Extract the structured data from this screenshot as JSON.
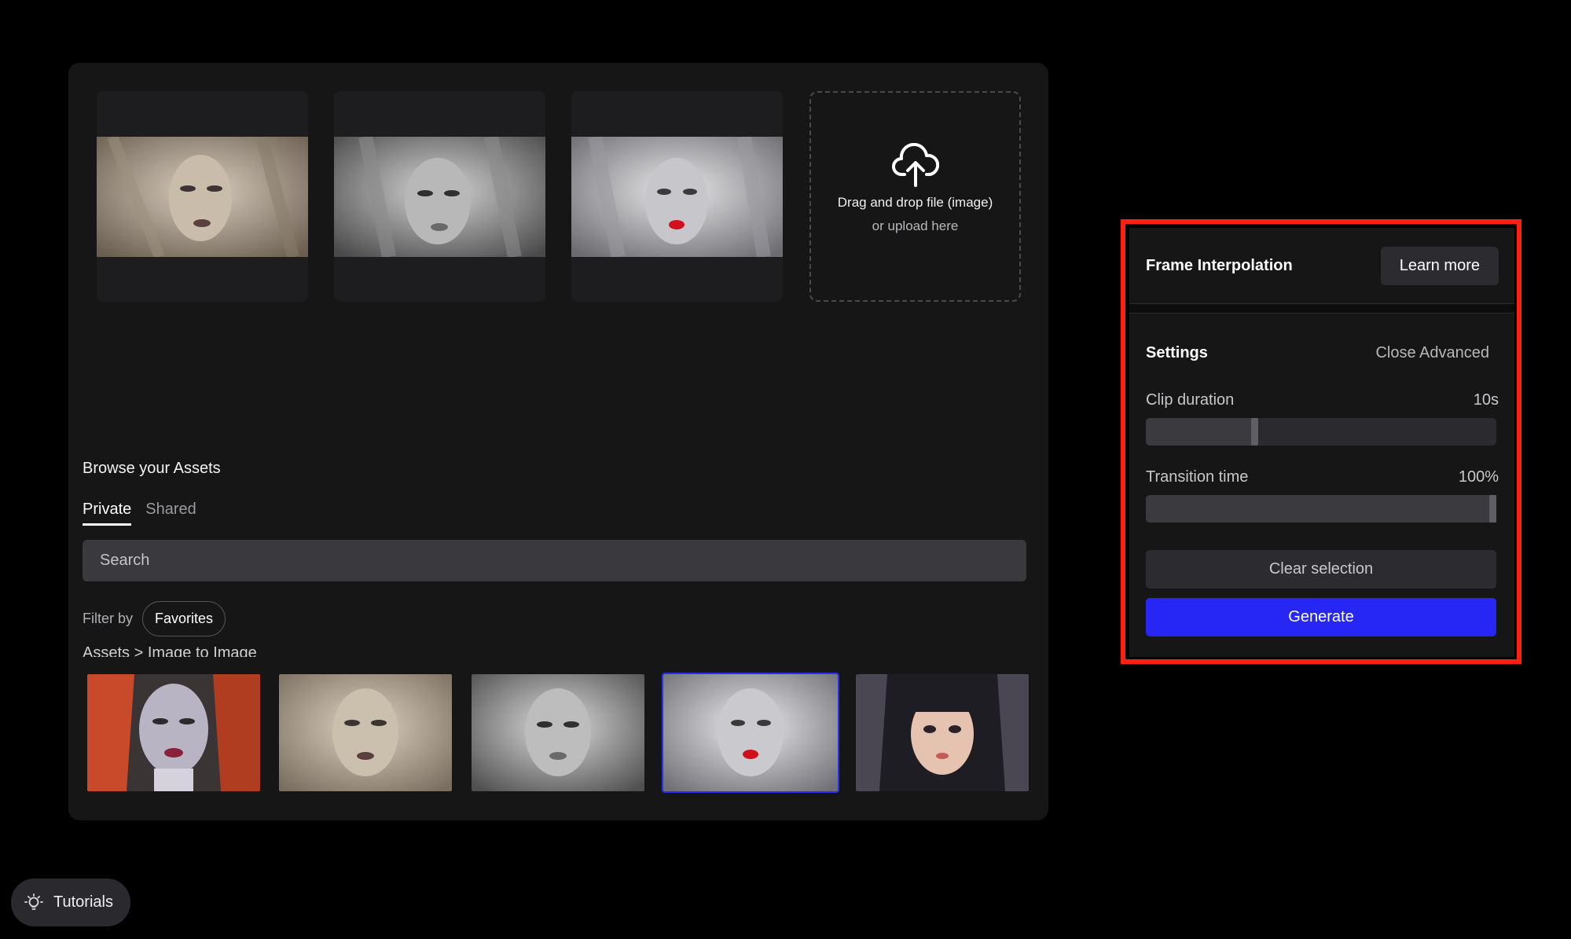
{
  "upload": {
    "line1": "Drag and drop file (image)",
    "line2": "or upload here",
    "icon": "cloud-upload-icon"
  },
  "browse": {
    "title": "Browse your Assets",
    "tabs": [
      {
        "label": "Private",
        "active": true
      },
      {
        "label": "Shared",
        "active": false
      }
    ],
    "search_placeholder": "Search",
    "filter_label": "Filter by",
    "filter_chip": "Favorites",
    "breadcrumb": "Assets > Image to Image"
  },
  "panel": {
    "title": "Frame Interpolation",
    "learn_more": "Learn more",
    "settings_title": "Settings",
    "close_advanced": "Close Advanced",
    "clip_duration": {
      "label": "Clip duration",
      "value": "10s",
      "fraction": 0.31
    },
    "transition_time": {
      "label": "Transition time",
      "value": "100%",
      "fraction": 1.0
    },
    "clear_label": "Clear selection",
    "generate_label": "Generate"
  },
  "tutorials": {
    "label": "Tutorials",
    "icon": "lightbulb-icon"
  },
  "colors": {
    "accent": "#2626f5",
    "highlight": "#ff2010",
    "panel_bg": "#161617"
  }
}
